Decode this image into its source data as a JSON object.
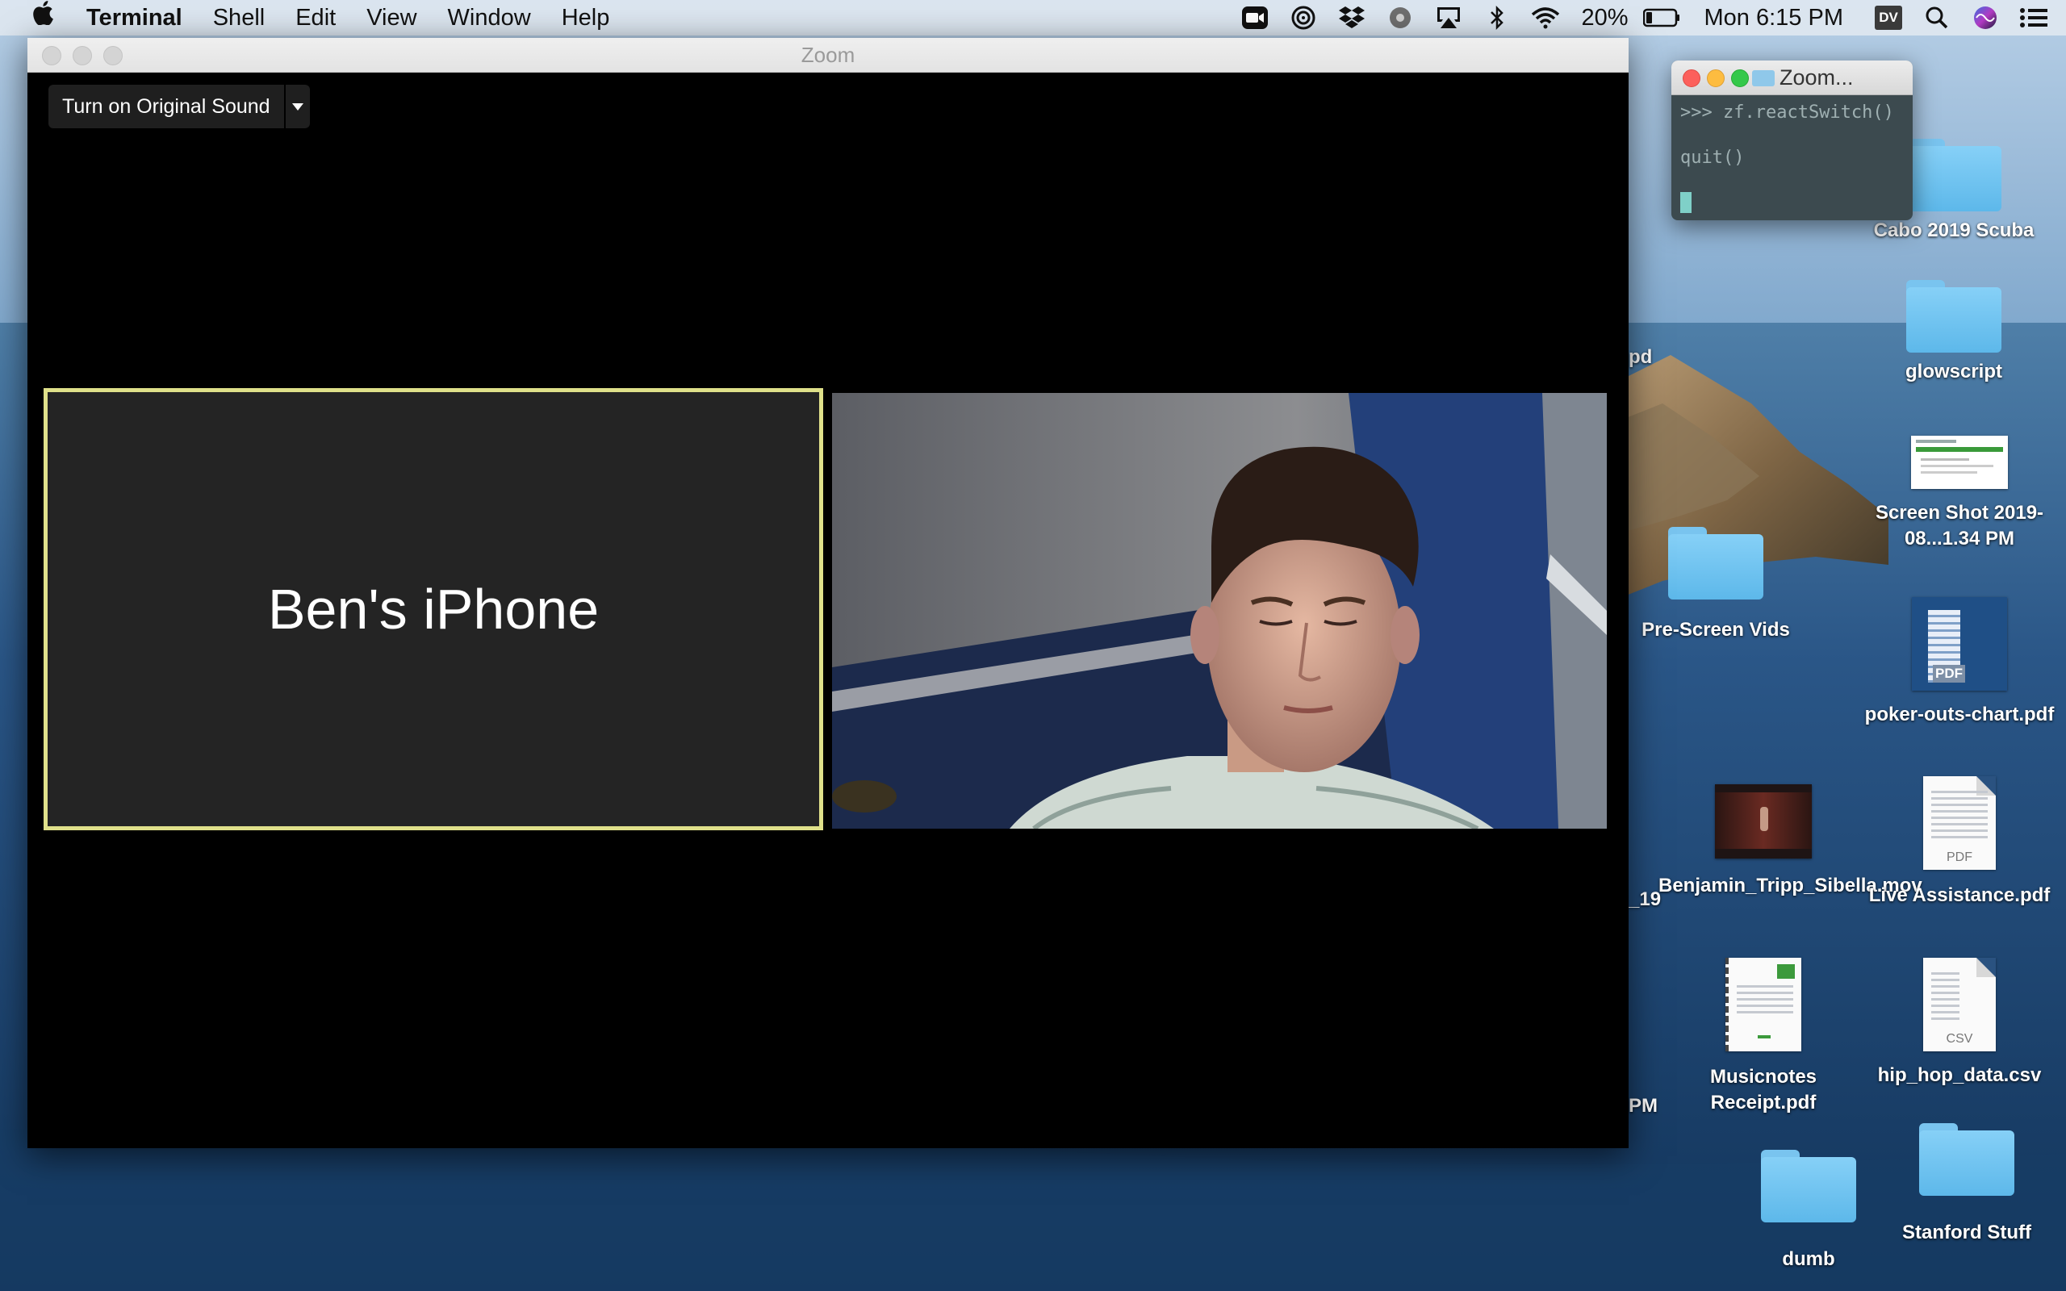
{
  "menubar": {
    "apple_icon": "apple-icon",
    "app_name": "Terminal",
    "menus": [
      "Shell",
      "Edit",
      "View",
      "Window",
      "Help"
    ],
    "battery_percent": "20%",
    "clock": "Mon 6:15 PM",
    "user_initials": "DV",
    "status_icons": [
      "zoom-icon",
      "audio-hijack-icon",
      "dropbox-icon",
      "vpn-icon",
      "airplay-icon",
      "bluetooth-icon",
      "wifi-icon",
      "battery-icon",
      "spotlight-icon",
      "siri-icon",
      "notification-center-icon"
    ]
  },
  "zoom": {
    "window_title": "Zoom",
    "original_sound_label": "Turn on Original Sound",
    "participants": [
      {
        "name": "Ben's iPhone",
        "video": false,
        "active_speaker": true
      },
      {
        "name": "",
        "video": true,
        "active_speaker": false
      }
    ],
    "speaker_highlight_color": "#dfe08a"
  },
  "terminal": {
    "title": "Zoom...",
    "lines": [
      ">>> zf.reactSwitch()",
      "",
      "quit()",
      ""
    ],
    "cursor_color": "#7fd0c8"
  },
  "desktop": {
    "icons": [
      {
        "label": "Cabo 2019 Scuba",
        "type": "folder"
      },
      {
        "label": "glowscript",
        "type": "folder"
      },
      {
        "label": "Screen Shot 2019-08...1.34 PM",
        "type": "screenshot"
      },
      {
        "label": "Pre-Screen Vids",
        "type": "folder"
      },
      {
        "label": "poker-outs-chart.pdf",
        "type": "pdf"
      },
      {
        "label": "Benjamin_Tripp_Sibella.mov",
        "type": "movie"
      },
      {
        "label": "Live Assistance.pdf",
        "type": "pdf"
      },
      {
        "label": "Musicnotes Receipt.pdf",
        "type": "pdf"
      },
      {
        "label": "hip_hop_data.csv",
        "type": "csv"
      },
      {
        "label": "dumb",
        "type": "folder"
      },
      {
        "label": "Stanford Stuff",
        "type": "folder"
      }
    ],
    "partial_labels": [
      "pd",
      "_19",
      "PM"
    ],
    "file_ext_labels": {
      "pdf": "PDF",
      "csv": "CSV"
    }
  }
}
